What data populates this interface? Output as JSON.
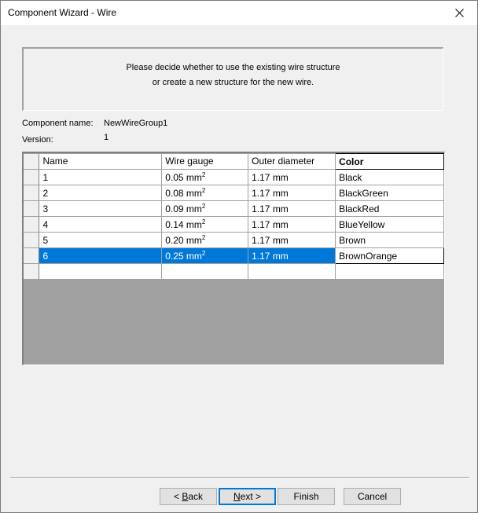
{
  "window": {
    "title": "Component Wizard - Wire"
  },
  "info": {
    "line1": "Please decide whether to use the existing wire structure",
    "line2": "or create a new structure for the new wire."
  },
  "fields": {
    "component_name_label": "Component name:",
    "component_name_value": "NewWireGroup1",
    "version_label": "Version:",
    "version_value": "1"
  },
  "table": {
    "columns": [
      "Name",
      "Wire gauge",
      "Outer diameter",
      "Color"
    ],
    "gauge_unit": "mm",
    "gauge_exp": "2",
    "rows": [
      {
        "name": "1",
        "gauge": "0.05",
        "diameter": "1.17 mm",
        "color": "Black"
      },
      {
        "name": "2",
        "gauge": "0.08",
        "diameter": "1.17 mm",
        "color": "BlackGreen"
      },
      {
        "name": "3",
        "gauge": "0.09",
        "diameter": "1.17 mm",
        "color": "BlackRed"
      },
      {
        "name": "4",
        "gauge": "0.14",
        "diameter": "1.17 mm",
        "color": "BlueYellow"
      },
      {
        "name": "5",
        "gauge": "0.20",
        "diameter": "1.17 mm",
        "color": "Brown"
      },
      {
        "name": "6",
        "gauge": "0.25",
        "diameter": "1.17 mm",
        "color": "BrownOrange"
      }
    ],
    "selected_row": 5,
    "selection_color": "#0078d7"
  },
  "buttons": {
    "back_prefix": "< ",
    "back_key": "B",
    "back_rest": "ack",
    "next_key": "N",
    "next_rest": "ext >",
    "finish": "Finish",
    "cancel": "Cancel"
  }
}
